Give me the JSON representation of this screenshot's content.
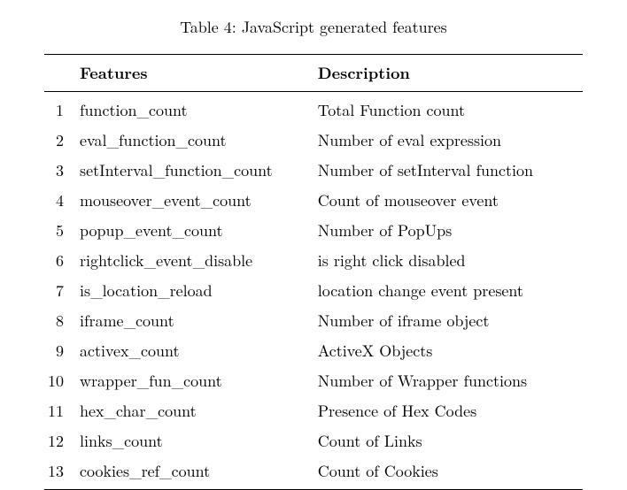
{
  "caption": "Table 4: JavaScript generated features",
  "headers": {
    "num": "",
    "features": "Features",
    "description": "Description"
  },
  "rows": [
    {
      "n": "1",
      "feature_parts": [
        "function",
        "count"
      ],
      "desc": "Total Function count"
    },
    {
      "n": "2",
      "feature_parts": [
        "eval",
        "function",
        "count"
      ],
      "desc": "Number of eval expression"
    },
    {
      "n": "3",
      "feature_parts": [
        "setInterval",
        "function",
        "count"
      ],
      "desc": "Number of setInterval function"
    },
    {
      "n": "4",
      "feature_parts": [
        "mouseover",
        "event",
        "count"
      ],
      "desc": "Count of mouseover event"
    },
    {
      "n": "5",
      "feature_parts": [
        "popup",
        "event",
        "count"
      ],
      "desc": "Number of PopUps"
    },
    {
      "n": "6",
      "feature_parts": [
        "rightclick",
        "event",
        "disable"
      ],
      "desc": "is right click disabled"
    },
    {
      "n": "7",
      "feature_parts": [
        "is",
        "location",
        "reload"
      ],
      "desc": "location change event present"
    },
    {
      "n": "8",
      "feature_parts": [
        "iframe",
        "count"
      ],
      "desc": "Number of iframe object"
    },
    {
      "n": "9",
      "feature_parts": [
        "activex",
        "count"
      ],
      "desc": "ActiveX Objects"
    },
    {
      "n": "10",
      "feature_parts": [
        "wrapper",
        "fun",
        "count"
      ],
      "desc": "Number of Wrapper functions"
    },
    {
      "n": "11",
      "feature_parts": [
        "hex",
        "char",
        "count"
      ],
      "desc": "Presence of Hex Codes"
    },
    {
      "n": "12",
      "feature_parts": [
        "links",
        "count"
      ],
      "desc": "Count of Links"
    },
    {
      "n": "13",
      "feature_parts": [
        "cookies",
        "ref",
        "count"
      ],
      "desc": "Count of Cookies"
    }
  ]
}
